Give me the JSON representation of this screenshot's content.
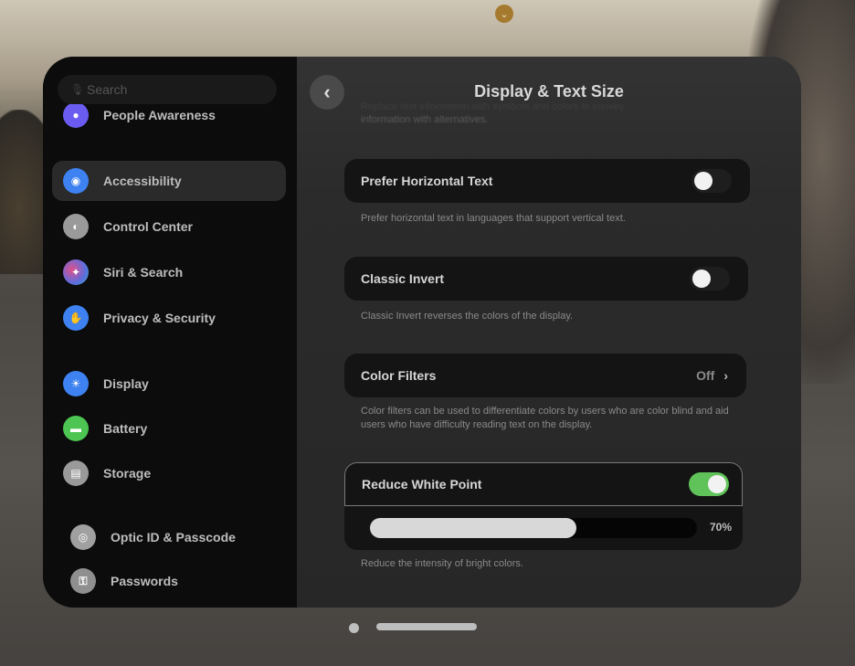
{
  "window": {
    "title": "Display & Text Size"
  },
  "sidebar": {
    "search_placeholder": "Search",
    "items": [
      {
        "label": "People Awareness",
        "icon": "people-awareness-icon",
        "color": "#6a5cf0",
        "glyph": "●"
      },
      {
        "label": "Accessibility",
        "icon": "accessibility-icon",
        "color": "#3d82f0",
        "glyph": "◉",
        "active": true
      },
      {
        "label": "Control Center",
        "icon": "control-center-icon",
        "color": "#9a9a9a",
        "glyph": "◐"
      },
      {
        "label": "Siri & Search",
        "icon": "siri-icon",
        "color": "#8a4fa0",
        "glyph": "✦"
      },
      {
        "label": "Privacy & Security",
        "icon": "privacy-hand-icon",
        "color": "#3d82f0",
        "glyph": "✋"
      },
      {
        "label": "Display",
        "icon": "display-icon",
        "color": "#3d82f0",
        "glyph": "☀"
      },
      {
        "label": "Battery",
        "icon": "battery-icon",
        "color": "#4cc552",
        "glyph": "▬"
      },
      {
        "label": "Storage",
        "icon": "storage-icon",
        "color": "#9a9a9a",
        "glyph": "▤"
      },
      {
        "label": "Optic ID & Passcode",
        "icon": "optic-id-icon",
        "color": "#a0a0a0",
        "glyph": "◎"
      },
      {
        "label": "Passwords",
        "icon": "key-icon",
        "color": "#8f8f8f",
        "glyph": "⚿"
      }
    ]
  },
  "main": {
    "back_label": "‹",
    "faded_text_line1": "Replace text information with symbols and colors to convey",
    "faded_text_line2": "information with alternatives.",
    "settings": [
      {
        "label": "Prefer Horizontal Text",
        "type": "toggle",
        "value": false,
        "footer": "Prefer horizontal text in languages that support vertical text."
      },
      {
        "label": "Classic Invert",
        "type": "toggle",
        "value": false,
        "footer": "Classic Invert reverses the colors of the display."
      },
      {
        "label": "Color Filters",
        "type": "link",
        "value": "Off",
        "footer": "Color filters can be used to differentiate colors by users who are color blind and aid users who have difficulty reading text on the display."
      },
      {
        "label": "Reduce White Point",
        "type": "toggle",
        "value": true,
        "slider_percent": 70,
        "slider_label": "70%",
        "footer": "Reduce the intensity of bright colors."
      }
    ]
  },
  "colors": {
    "toggle_on": "#5fc35a",
    "accent": "#3d82f0"
  }
}
